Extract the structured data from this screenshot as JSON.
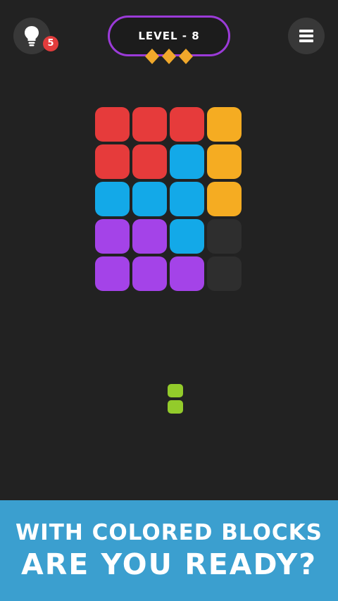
{
  "header": {
    "hint_count": "5",
    "level_label": "LEVEL - 8",
    "stars_earned": 3,
    "stars_color": "#f0a82b",
    "pill_border_color": "#9b3bd8"
  },
  "colors": {
    "R": "#e63b3b",
    "Y": "#f5ac22",
    "B": "#13a9e8",
    "P": "#a443e8",
    "E": "#2e2e2e",
    "G": "#93cb2b"
  },
  "board": {
    "rows": [
      [
        "R",
        "R",
        "R",
        "Y"
      ],
      [
        "R",
        "R",
        "B",
        "Y"
      ],
      [
        "B",
        "B",
        "B",
        "Y"
      ],
      [
        "P",
        "P",
        "B",
        "E"
      ],
      [
        "P",
        "P",
        "P",
        "E"
      ]
    ]
  },
  "piece": {
    "color": "G",
    "cells": 2,
    "orientation": "vertical"
  },
  "banner": {
    "line1": "WITH COLORED BLOCKS",
    "line2": "ARE YOU READY?"
  }
}
